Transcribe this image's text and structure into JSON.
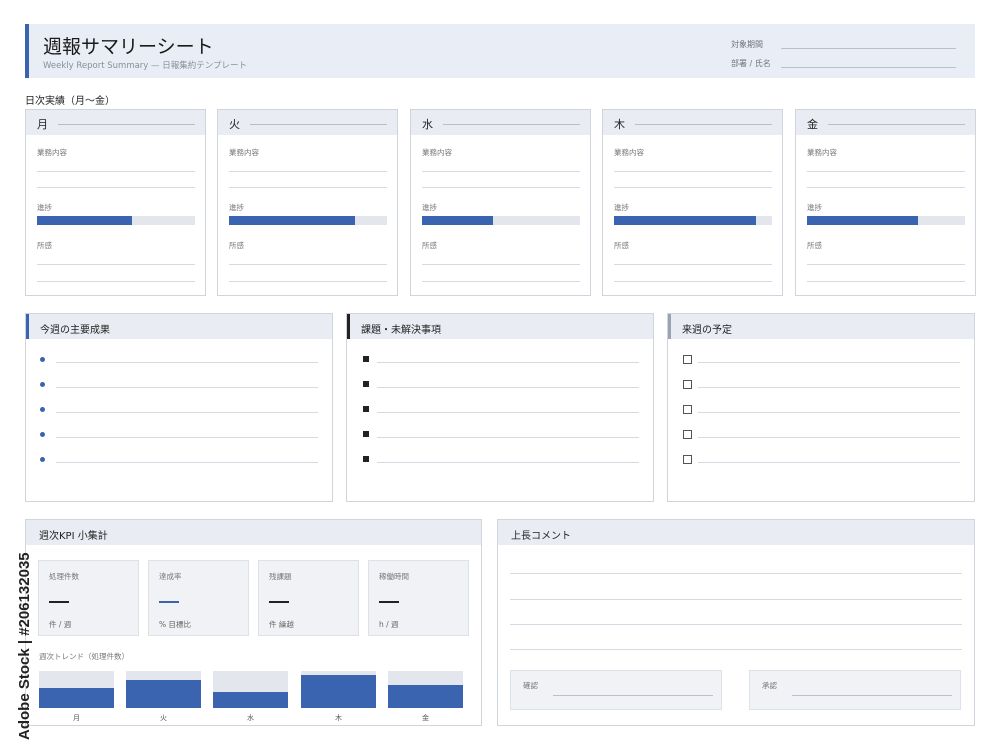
{
  "header": {
    "title": "週報サマリーシート",
    "subtitle": "Weekly Report Summary — 日報集約テンプレート",
    "meta": [
      {
        "label": "対象期間"
      },
      {
        "label": "部署 / 氏名"
      }
    ]
  },
  "daily": {
    "section_label": "日次実績（月〜金）",
    "field_work": "業務内容",
    "field_progress": "進捗",
    "field_notes": "所感",
    "days": [
      {
        "name": "月",
        "progress": 0.6
      },
      {
        "name": "火",
        "progress": 0.8
      },
      {
        "name": "水",
        "progress": 0.45
      },
      {
        "name": "木",
        "progress": 0.9
      },
      {
        "name": "金",
        "progress": 0.7
      }
    ]
  },
  "panels": {
    "achievements": {
      "title": "今週の主要成果",
      "bullet_icon": "blue-dot-icon",
      "items": 5
    },
    "issues": {
      "title": "課題・未解決事項",
      "bullet_icon": "black-square-icon",
      "items": 5
    },
    "next_week": {
      "title": "来週の予定",
      "bullet_icon": "checkbox-icon",
      "items": 5
    }
  },
  "kpi": {
    "title": "週次KPI 小集計",
    "boxes": [
      {
        "label": "処理件数",
        "value": "—",
        "unit": "件 / 週",
        "accent": "#222222"
      },
      {
        "label": "達成率",
        "value": "—",
        "unit": "% 目標比",
        "accent": "#3a64b0"
      },
      {
        "label": "残課題",
        "value": "—",
        "unit": "件 繰越",
        "accent": "#222222"
      },
      {
        "label": "稼働時間",
        "value": "—",
        "unit": "h / 週",
        "accent": "#222222"
      }
    ],
    "trend_label": "週次トレンド（処理件数）",
    "trend": [
      {
        "day": "月",
        "value": 0.55
      },
      {
        "day": "火",
        "value": 0.75
      },
      {
        "day": "水",
        "value": 0.42
      },
      {
        "day": "木",
        "value": 0.88
      },
      {
        "day": "金",
        "value": 0.62
      }
    ]
  },
  "comment": {
    "title": "上長コメント",
    "confirm_label": "確認",
    "approve_label": "承認"
  },
  "watermark": "Adobe Stock | #206132035",
  "colors": {
    "accent": "#3a64b0",
    "header_bg": "#e9edf5",
    "panel_head_bg": "#e9ecf2"
  }
}
